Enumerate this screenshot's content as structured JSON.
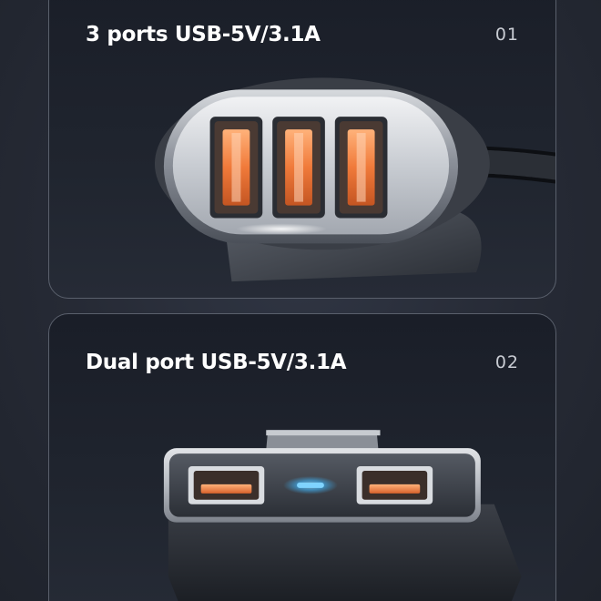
{
  "panels": [
    {
      "title": "3 ports USB-5V/3.1A",
      "index": "01"
    },
    {
      "title": "Dual port USB-5V/3.1A",
      "index": "02"
    }
  ],
  "colors": {
    "background": "#262a35",
    "panel_border": "#5a606c",
    "port_glow": "#f08a4b",
    "indicator_led": "#3fb8ff"
  }
}
